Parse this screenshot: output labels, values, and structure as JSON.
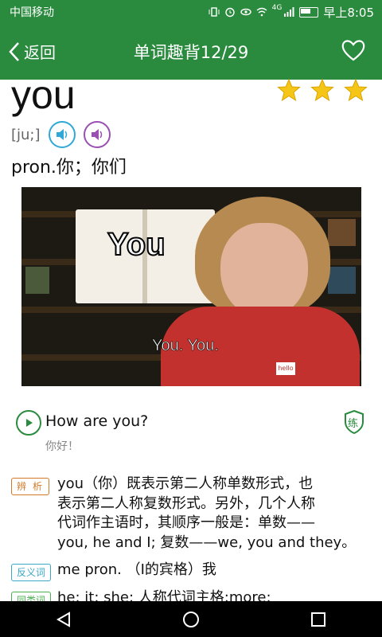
{
  "status_bar": {
    "carrier": "中国移动",
    "network": "4G",
    "time": "早上8:05"
  },
  "header": {
    "back_label": "返回",
    "title": "单词趣背12/29"
  },
  "word": {
    "text": "you",
    "rating_stars": 3,
    "phonetic": "[ju;]",
    "meaning": "pron.你；你们"
  },
  "video": {
    "overlay_word": "You",
    "subtitle": "You. You.",
    "tag_text": "hello"
  },
  "example": {
    "sentence": "How are you?",
    "translation": "你好！",
    "practice_label": "练"
  },
  "analysis": {
    "tag": "辨析",
    "lines": [
      "you（你）既表示第二人称单数形式，也",
      "表示第二人称复数形式。另外，几个人称",
      "代词作主语时，其顺序一般是：单数——",
      "you, he and I; 复数——we, you and they。"
    ]
  },
  "antonym": {
    "tag": "反义词",
    "text": "me pron. （I的宾格）我"
  },
  "synonym": {
    "tag": "同类词",
    "text": "he; it; she; 人称代词主格;more;"
  },
  "colors": {
    "primary": "#2a8b3e",
    "star": "#f5c518",
    "analysis_tag": "#d27a2a",
    "antonym_tag": "#3aa7c6"
  }
}
